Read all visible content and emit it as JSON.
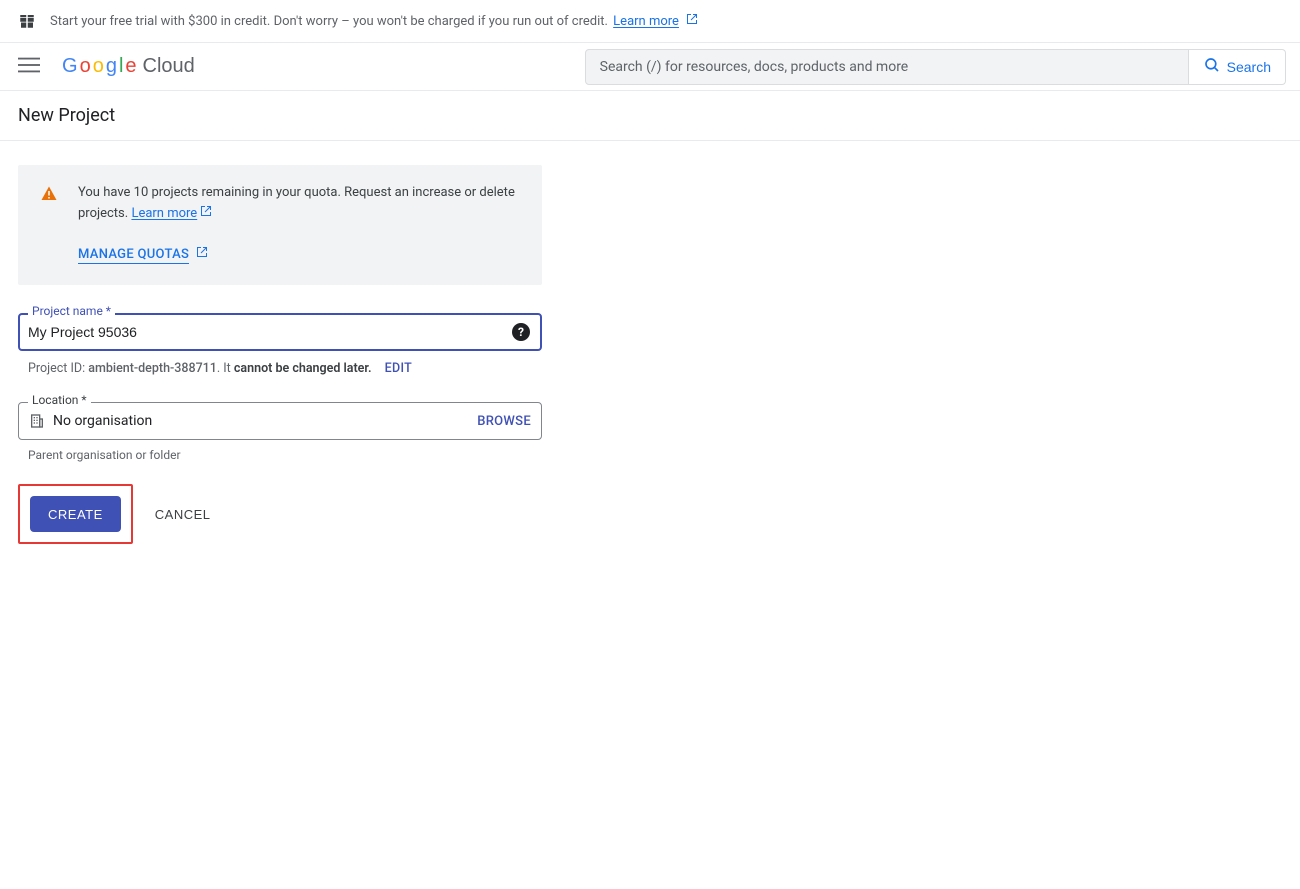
{
  "trial": {
    "text": "Start your free trial with $300 in credit. Don't worry – you won't be charged if you run out of credit.",
    "learn_more": "Learn more"
  },
  "header": {
    "logo_text": "Google",
    "logo_suffix": "Cloud",
    "search_placeholder": "Search (/) for resources, docs, products and more",
    "search_button": "Search"
  },
  "page": {
    "title": "New Project"
  },
  "quota": {
    "message": "You have 10 projects remaining in your quota. Request an increase or delete projects.",
    "learn_more": "Learn more",
    "manage": "MANAGE QUOTAS"
  },
  "form": {
    "project_name": {
      "label": "Project name *",
      "value": "My Project 95036"
    },
    "project_id": {
      "prefix": "Project ID:",
      "value": "ambient-depth-388711",
      "mid": ". It",
      "suffix": "cannot be changed later.",
      "edit": "EDIT"
    },
    "location": {
      "label": "Location *",
      "value": "No organisation",
      "browse": "BROWSE",
      "helper": "Parent organisation or folder"
    },
    "buttons": {
      "create": "CREATE",
      "cancel": "CANCEL"
    }
  }
}
